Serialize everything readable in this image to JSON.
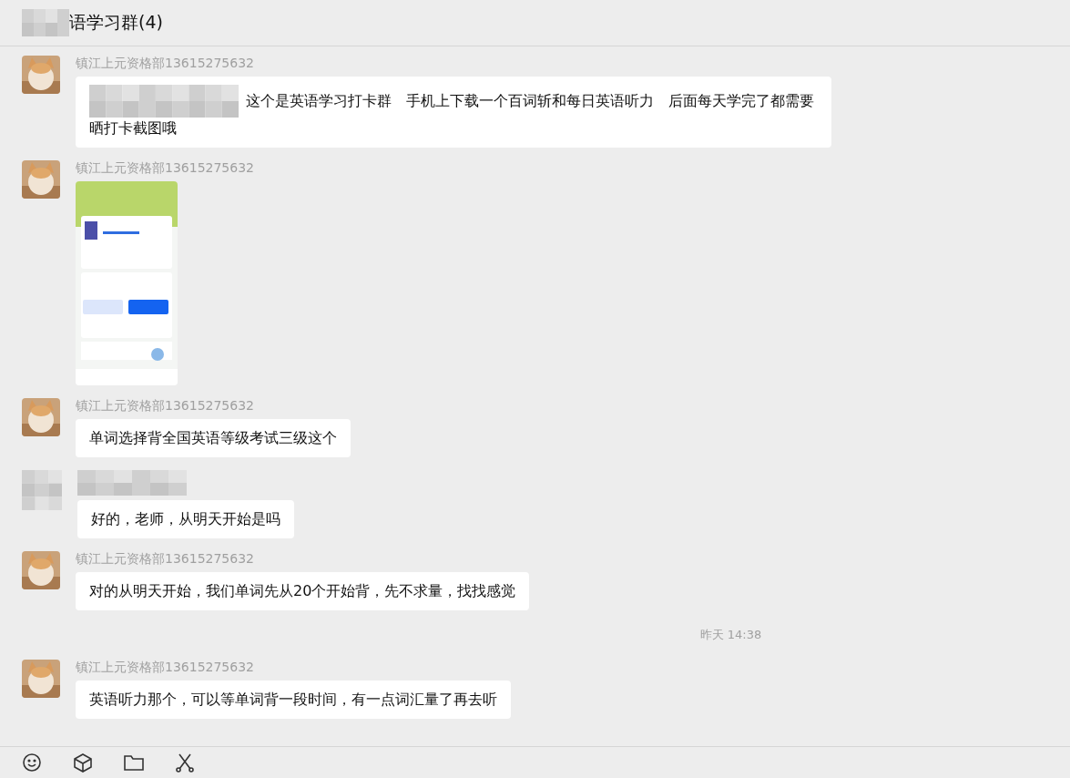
{
  "header": {
    "title": "语学习群(4)",
    "redacted_prefix": true
  },
  "messages": [
    {
      "kind": "text",
      "sender": "镇江上元资格部13615275632",
      "redacted_sender": false,
      "redacted_lead": true,
      "text": "这个是英语学习打卡群　手机上下载一个百词斩和每日英语听力　后面每天学完了都需要晒打卡截图哦"
    },
    {
      "sender": "镇江上元资格部13615275632",
      "redacted_sender": false
    },
    {
      "kind": "text",
      "sender": "镇江上元资格部13615275632",
      "redacted_sender": false,
      "redacted_lead": false,
      "text": "单词选择背全国英语等级考试三级这个"
    },
    {
      "kind": "text",
      "redacted_sender": true,
      "redacted_lead": false,
      "text": "好的，老师，从明天开始是吗"
    },
    {
      "kind": "text",
      "sender": "镇江上元资格部13615275632",
      "redacted_sender": false,
      "redacted_lead": false,
      "text": "对的从明天开始，我们单词先从20个开始背，先不求量，找找感觉"
    },
    {
      "kind": "time",
      "text": "昨天 14:38"
    },
    {
      "kind": "text",
      "sender": "镇江上元资格部13615275632",
      "redacted_sender": false,
      "redacted_lead": false,
      "text": "英语听力那个，可以等单词背一段时间，有一点词汇量了再去听"
    }
  ],
  "toolbar": [
    {
      "kind": "emoji"
    },
    {
      "kind": "cube"
    },
    {
      "kind": "folder"
    },
    {
      "kind": "scissors"
    }
  ]
}
